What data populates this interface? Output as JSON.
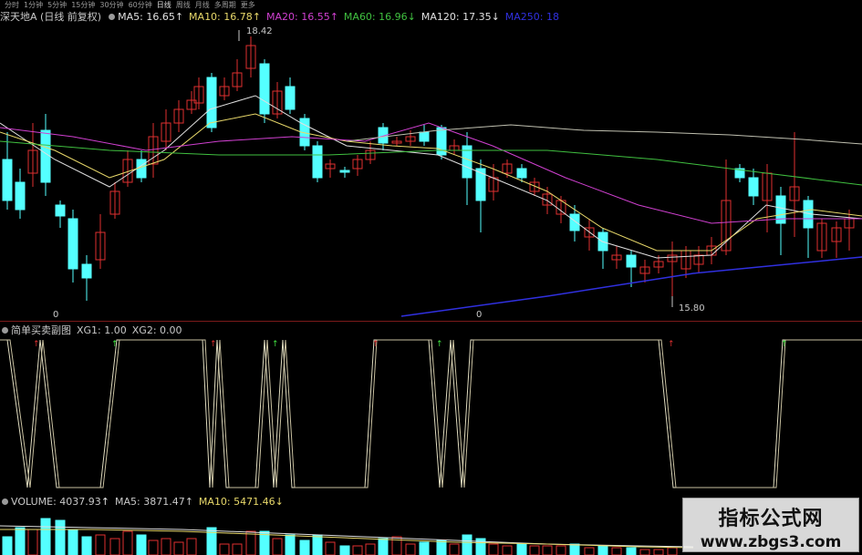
{
  "timeframes": [
    "分时",
    "1分钟",
    "5分钟",
    "15分钟",
    "30分钟",
    "60分钟",
    "日线",
    "周线",
    "月线",
    "多周期",
    "更多"
  ],
  "active_timeframe": "日线",
  "main": {
    "title": "深天地A (日线 前复权)",
    "ma": [
      {
        "label": "MA5: 16.65",
        "arrow": "↑",
        "color": "#e0e0e0"
      },
      {
        "label": "MA10: 16.78",
        "arrow": "↑",
        "color": "#e8d86a"
      },
      {
        "label": "MA20: 16.55",
        "arrow": "↑",
        "color": "#d040d0"
      },
      {
        "label": "MA60: 16.96",
        "arrow": "↓",
        "color": "#40c040"
      },
      {
        "label": "MA120: 17.35",
        "arrow": "↓",
        "color": "#e0e0e0"
      },
      {
        "label": "MA250: 18",
        "arrow": "",
        "color": "#3030e0"
      }
    ],
    "high_label": "18.42",
    "low_label": "15.80",
    "marker_left": "0",
    "marker_mid": "0"
  },
  "indicator": {
    "title": "简单买卖副图",
    "xg1": "XG1: 1.00",
    "xg2": "XG2: 0.00"
  },
  "volume": {
    "label": "VOLUME: 4037.93",
    "label_arrow": "↑",
    "ma5": "MA5: 3871.47",
    "ma5_arrow": "↑",
    "ma10": "MA10: 5471.46",
    "ma10_arrow": "↓"
  },
  "watermark": {
    "line1": "指标公式网",
    "line2": "www.zbgs3.com"
  },
  "colors": {
    "up": "#e03030",
    "down": "#54ffff",
    "bg": "#000000"
  }
}
